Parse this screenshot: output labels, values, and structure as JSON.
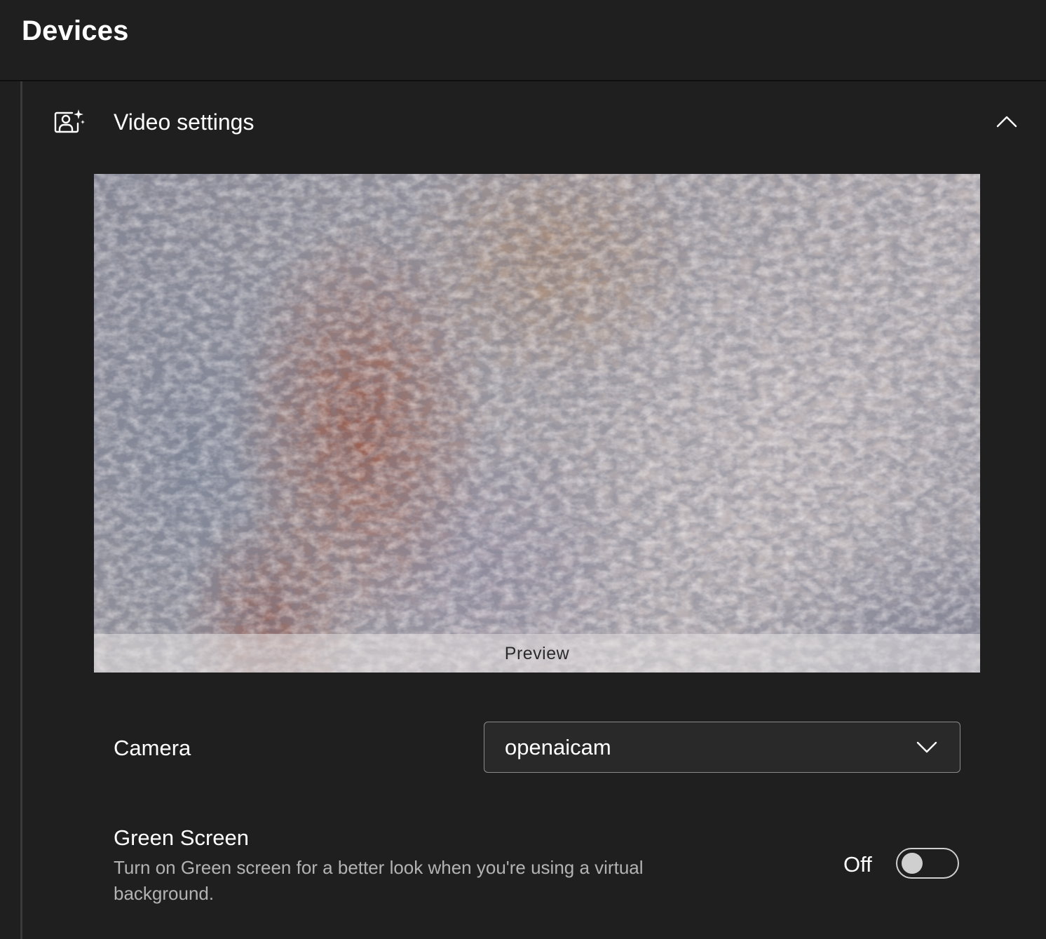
{
  "header": {
    "title": "Devices"
  },
  "video_settings": {
    "icon": "camera-sparkle-icon",
    "title": "Video settings",
    "collapse_icon": "chevron-up-icon",
    "expanded": true
  },
  "preview": {
    "label": "Preview"
  },
  "camera": {
    "label": "Camera",
    "selected": "openaicam",
    "dropdown_icon": "chevron-down-icon"
  },
  "green_screen": {
    "title": "Green Screen",
    "description": "Turn on Green screen for a better look when you're using a virtual background.",
    "state_label": "Off",
    "enabled": false
  },
  "colors": {
    "background": "#1f1f1f",
    "text_primary": "#ffffff",
    "text_secondary": "#b3b3b3",
    "border": "#8a8a8a"
  }
}
